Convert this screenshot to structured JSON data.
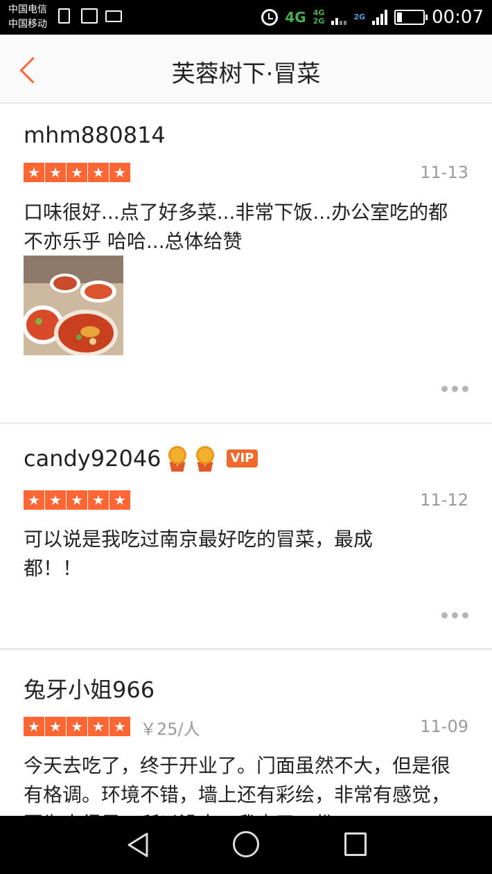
{
  "status_bar": {
    "carriers": [
      "中国电信",
      "中国移动"
    ],
    "network_4g": "4G",
    "sim_small_1": "4G",
    "sim_small_2": "2G",
    "sim_small_3": "2G",
    "battery_level": 0.2,
    "time": "00:07"
  },
  "header": {
    "title": "芙蓉树下·冒菜"
  },
  "reviews": [
    {
      "user": "mhm880814",
      "rating": 5,
      "date": "11-13",
      "text": "口味很好...点了好多菜...非常下饭...办公室吃的都不亦乐乎 哈哈...总体给赞",
      "has_photo": true
    },
    {
      "user": "candy92046",
      "medals": 2,
      "badge": "VIP",
      "rating": 5,
      "date": "11-12",
      "text": "可以说是我吃过南京最好吃的冒菜，最成都！！"
    },
    {
      "user": "兔牙小姐966",
      "rating": 5,
      "price": "￥25/人",
      "date": "11-09",
      "text": "今天去吃了，终于开业了。门面虽然不大，但是很有格调。环境不错，墙上还有彩绘，非常有感觉，因为去得早，所以没人，我点了一份"
    }
  ],
  "icons": {
    "back": "chevron-left-icon",
    "star": "star-icon",
    "more": "more-dots-icon",
    "medal": "medal-icon"
  },
  "colors": {
    "accent": "#ff6633",
    "secondary_text": "#999999"
  }
}
